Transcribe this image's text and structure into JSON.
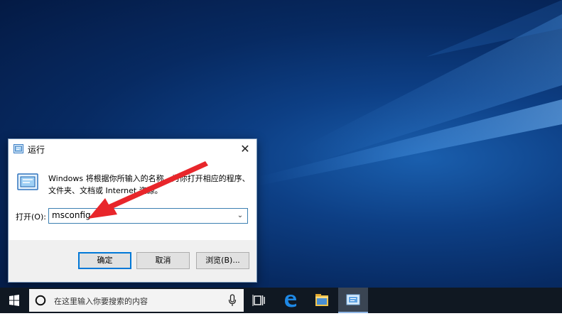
{
  "dialog": {
    "title": "运行",
    "close_glyph": "✕",
    "description": "Windows 将根据你所输入的名称，为你打开相应的程序、文件夹、文档或 Internet 资源。",
    "open_label": "打开(O):",
    "open_value": "msconfig",
    "dropdown_glyph": "⌄",
    "buttons": {
      "ok": "确定",
      "cancel": "取消",
      "browse": "浏览(B)..."
    }
  },
  "taskbar": {
    "search_placeholder": "在这里输入你要搜索的内容",
    "icons": [
      "windows-start-icon",
      "cortana-icon",
      "microphone-icon",
      "task-view-icon",
      "edge-icon",
      "file-explorer-icon",
      "run-icon"
    ]
  },
  "colors": {
    "annotation_arrow": "#e8262b",
    "accent": "#0078d7",
    "taskbar": "#101822"
  }
}
